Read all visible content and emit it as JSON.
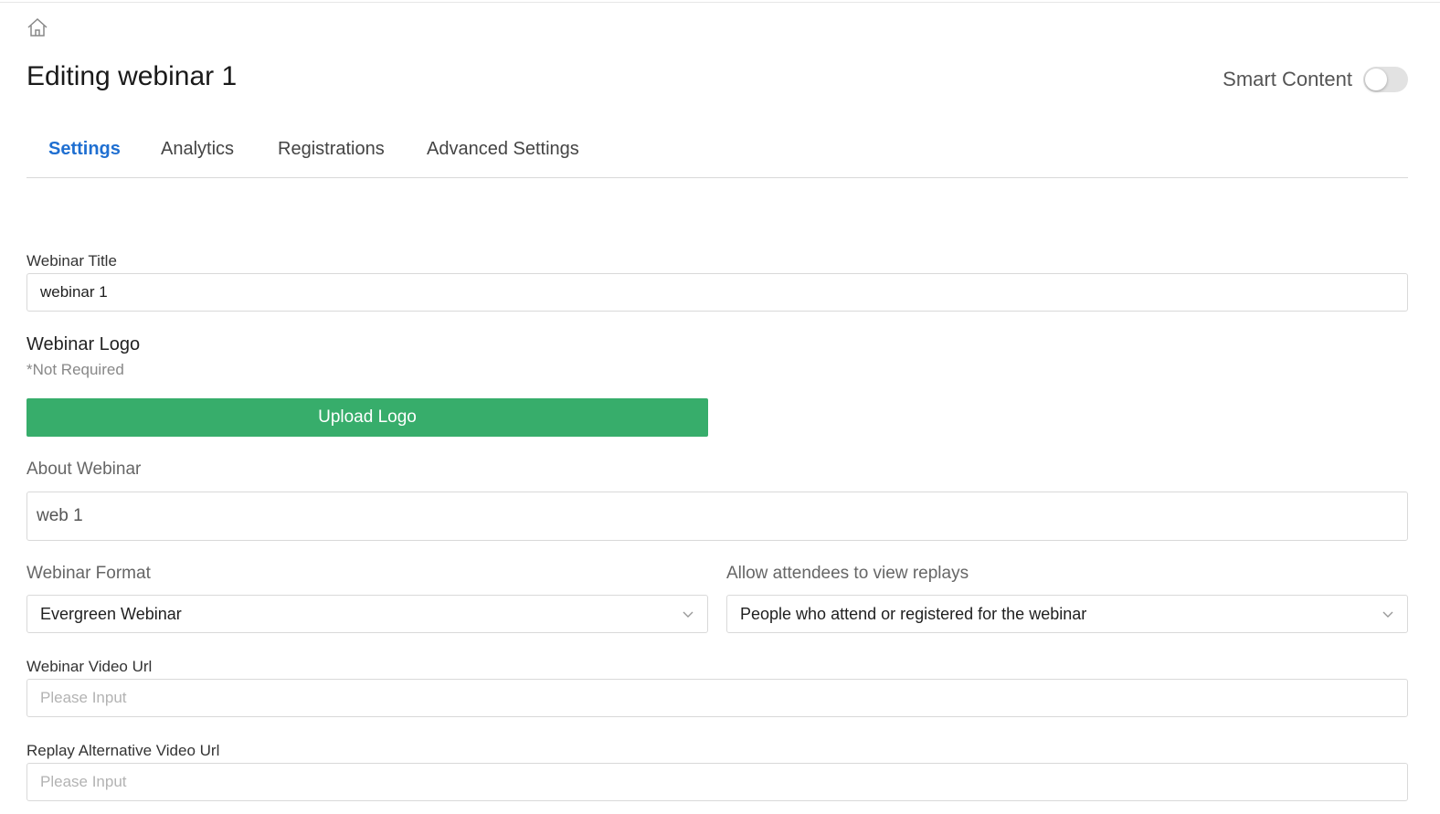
{
  "header": {
    "title": "Editing webinar 1",
    "smart_content_label": "Smart Content",
    "smart_content_enabled": false
  },
  "tabs": [
    {
      "label": "Settings",
      "active": true
    },
    {
      "label": "Analytics",
      "active": false
    },
    {
      "label": "Registrations",
      "active": false
    },
    {
      "label": "Advanced Settings",
      "active": false
    }
  ],
  "form": {
    "title_label": "Webinar Title",
    "title_value": "webinar 1",
    "logo_label": "Webinar Logo",
    "logo_note": "*Not Required",
    "upload_button": "Upload Logo",
    "about_label": "About Webinar",
    "about_value": "web 1",
    "format_label": "Webinar Format",
    "format_value": "Evergreen Webinar",
    "replay_label": "Allow attendees to view replays",
    "replay_value": "People who attend or registered for the webinar",
    "video_url_label": "Webinar Video Url",
    "video_url_placeholder": "Please Input",
    "replay_alt_label": "Replay Alternative Video Url",
    "replay_alt_placeholder": "Please Input"
  },
  "colors": {
    "accent": "#1f6fd1",
    "upload_button": "#37ad6b",
    "toggle_off": "#e2e2e2"
  },
  "icons": {
    "home": "home-icon",
    "chevron": "chevron-down-icon"
  }
}
